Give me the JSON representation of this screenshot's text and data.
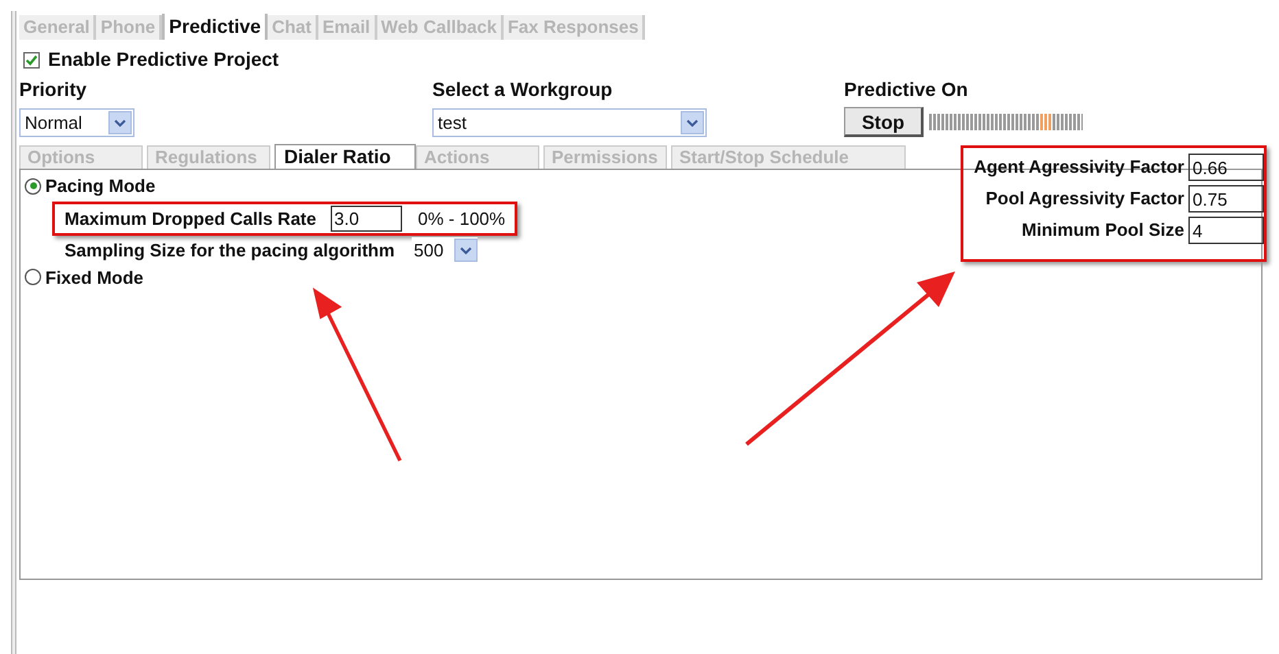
{
  "tabs": [
    {
      "label": "General",
      "selected": false
    },
    {
      "label": "Phone",
      "selected": false
    },
    {
      "label": "Predictive",
      "selected": true
    },
    {
      "label": "Chat",
      "selected": false
    },
    {
      "label": "Email",
      "selected": false
    },
    {
      "label": "Web Callback",
      "selected": false
    },
    {
      "label": "Fax Responses",
      "selected": false
    }
  ],
  "enable_predictive": {
    "label": "Enable Predictive Project",
    "checked": true
  },
  "priority": {
    "label": "Priority",
    "value": "Normal"
  },
  "workgroup": {
    "label": "Select a Workgroup",
    "value": "test"
  },
  "predictive_status": {
    "label": "Predictive On",
    "button": "Stop"
  },
  "sub_tabs": [
    {
      "label": "Options",
      "selected": false
    },
    {
      "label": "Regulations",
      "selected": false
    },
    {
      "label": "Dialer Ratio",
      "selected": true
    },
    {
      "label": "Actions",
      "selected": false
    },
    {
      "label": "Permissions",
      "selected": false
    },
    {
      "label": "Start/Stop Schedule",
      "selected": false
    }
  ],
  "modes": [
    {
      "label": "Pacing Mode",
      "selected": true
    },
    {
      "label": "Fixed Mode",
      "selected": false
    }
  ],
  "max_dropped": {
    "label": "Maximum Dropped Calls Rate",
    "value": "3.0",
    "range": "0% - 100%"
  },
  "sampling": {
    "label": "Sampling Size for the pacing algorithm",
    "value": "500"
  },
  "factors": [
    {
      "label": "Agent Agressivity Factor",
      "value": "0.66"
    },
    {
      "label": "Pool Agressivity Factor",
      "value": "0.75"
    },
    {
      "label": "Minimum Pool Size",
      "value": "4"
    }
  ]
}
